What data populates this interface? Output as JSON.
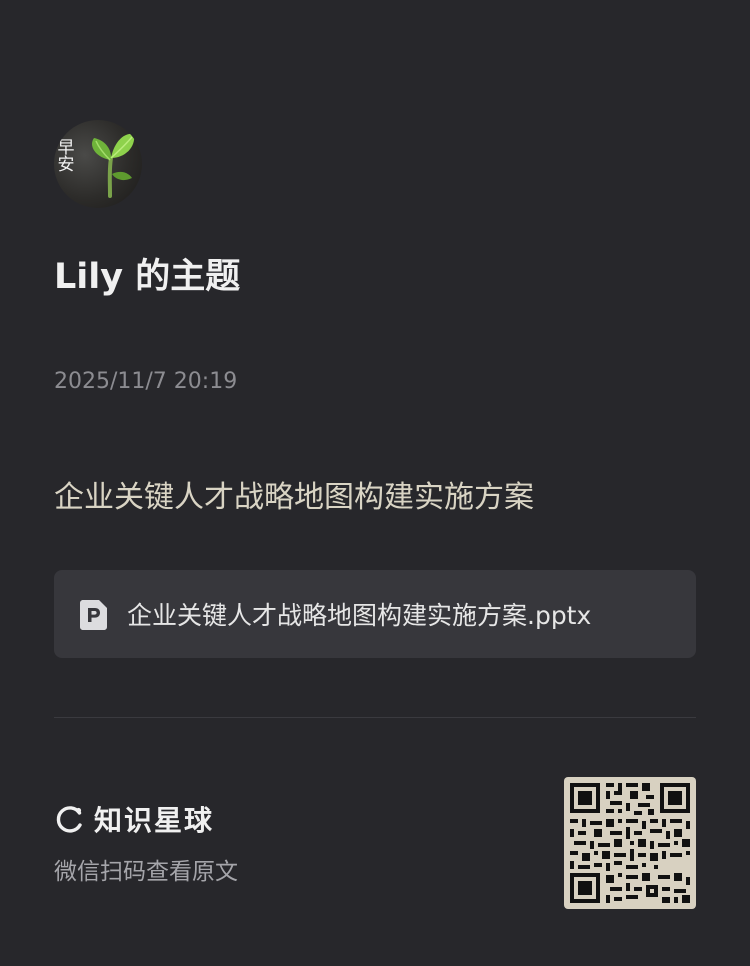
{
  "avatar": {
    "glyph": "早安",
    "icon": "sprout-icon"
  },
  "topic": {
    "title": "Lily 的主题",
    "timestamp": "2025/11/7 20:19",
    "description": "企业关键人才战略地图构建实施方案"
  },
  "attachment": {
    "icon": "pptx-file-icon",
    "file_name": "企业关键人才战略地图构建实施方案.pptx"
  },
  "footer": {
    "brand_icon": "knowledge-planet-icon",
    "brand_name": "知识星球",
    "hint": "微信扫码查看原文",
    "qr_icon": "qr-code-icon"
  },
  "colors": {
    "background": "#27272b",
    "card": "#37373c",
    "description_text": "#d9d4c4",
    "muted_text": "#8c8c91",
    "qr_background": "#d8d1c1"
  }
}
